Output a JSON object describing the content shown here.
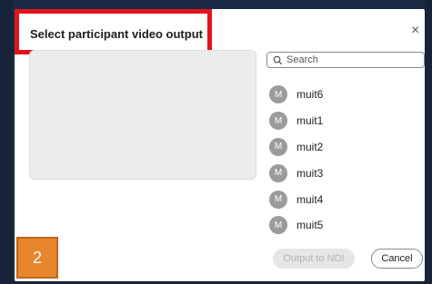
{
  "dialog": {
    "title": "Select participant video output",
    "close_glyph": "×"
  },
  "search": {
    "placeholder": "Search",
    "icon": "search-icon"
  },
  "participants": [
    {
      "initial": "M",
      "name": "muit6"
    },
    {
      "initial": "M",
      "name": "muit1"
    },
    {
      "initial": "M",
      "name": "muit2"
    },
    {
      "initial": "M",
      "name": "muit3"
    },
    {
      "initial": "M",
      "name": "muit4"
    },
    {
      "initial": "M",
      "name": "muit5"
    }
  ],
  "buttons": {
    "output": "Output to NDI",
    "cancel": "Cancel"
  },
  "annotation": {
    "step": "2"
  },
  "colors": {
    "highlight_border": "#e0151c",
    "badge": "#e8862b",
    "avatar": "#9b9b9b",
    "background": "#1b2a44"
  }
}
